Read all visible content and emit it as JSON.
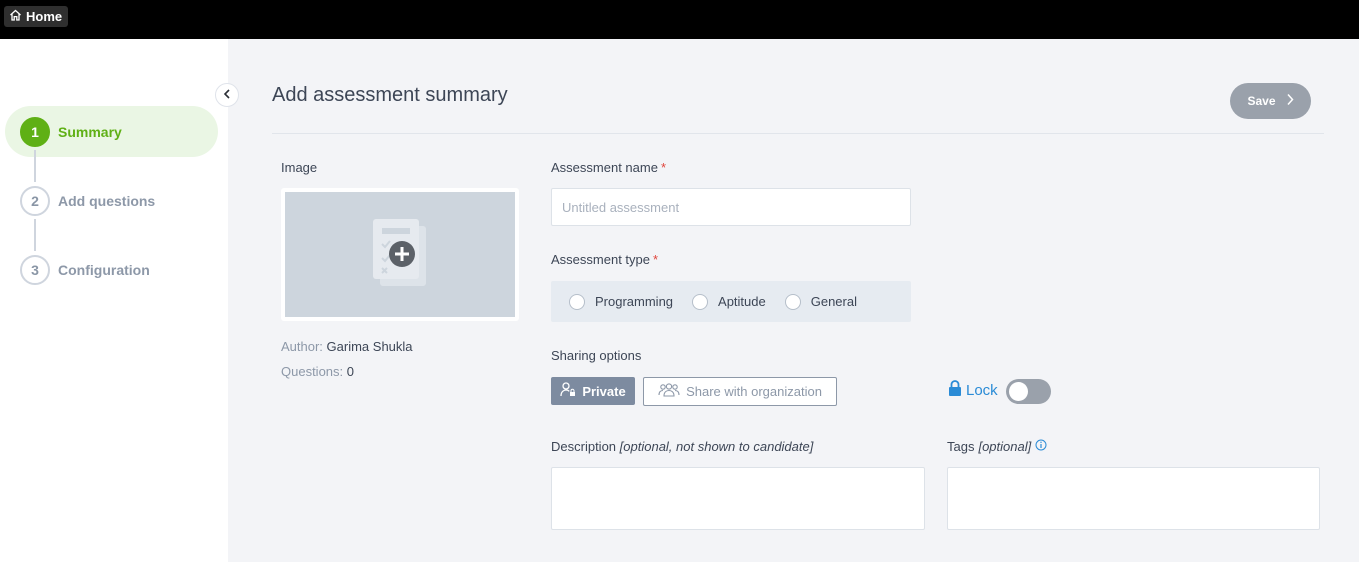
{
  "topbar": {
    "home_label": "Home"
  },
  "steps": [
    {
      "number": "1",
      "label": "Summary",
      "active": true
    },
    {
      "number": "2",
      "label": "Add questions",
      "active": false
    },
    {
      "number": "3",
      "label": "Configuration",
      "active": false
    }
  ],
  "header": {
    "title": "Add assessment summary",
    "save_label": "Save"
  },
  "image_section": {
    "label": "Image",
    "author_label": "Author:",
    "author_value": "Garima Shukla",
    "questions_label": "Questions:",
    "questions_value": "0"
  },
  "form": {
    "name_label": "Assessment name",
    "name_required": "*",
    "name_placeholder": "Untitled assessment",
    "type_label": "Assessment type",
    "type_required": "*",
    "type_options": [
      "Programming",
      "Aptitude",
      "General"
    ],
    "sharing_label": "Sharing options",
    "sharing_private": "Private",
    "sharing_org": "Share with organization",
    "lock_label": "Lock",
    "description_label": "Description",
    "description_hint": "[optional, not shown to candidate]",
    "tags_label": "Tags",
    "tags_hint": "[optional]"
  },
  "colors": {
    "accent_green": "#5fb015",
    "lock_blue": "#2a8bd6",
    "required_red": "#e0453c"
  }
}
